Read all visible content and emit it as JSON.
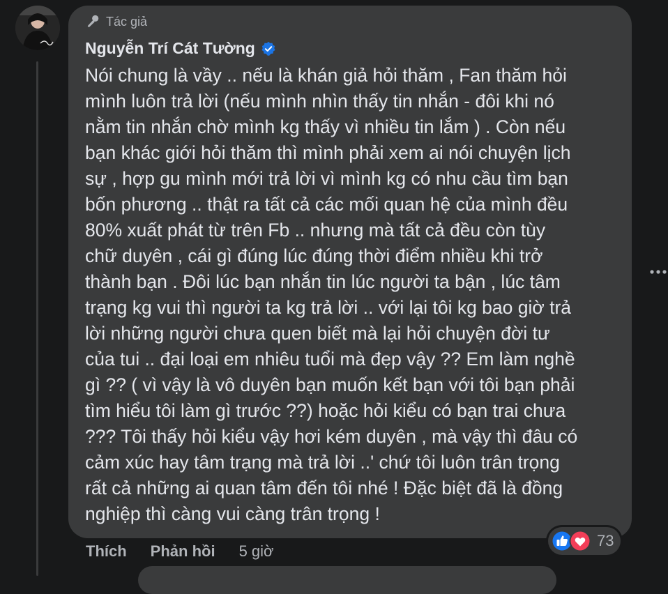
{
  "comment": {
    "badge_label": "Tác giả",
    "author_name": "Nguyễn Trí Cát Tường",
    "text": "Nói chung là vầy .. nếu là khán giả hỏi thăm , Fan thăm hỏi\nmình luôn trả lời (nếu mình nhìn thấy tin nhắn - đôi khi nó\nnằm tin nhắn chờ mình kg thấy vì nhiều tin lắm ) . Còn nếu\nbạn khác giới hỏi thăm thì mình phải xem ai nói chuyện lịch\nsự , hợp gu mình mới trả lời vì mình kg có nhu cầu tìm bạn\nbốn phương .. thật ra tất cả các mối quan hệ của mình đều\n80% xuất phát từ trên Fb .. nhưng mà tất cả đều còn tùy\nchữ duyên , cái gì đúng lúc đúng thời điểm nhiều khi trở\nthành bạn . Đôi lúc bạn nhắn tin lúc người ta bận , lúc tâm\ntrạng kg vui thì người ta kg trả lời .. với lại tôi kg bao giờ trả\nlời những người chưa quen biết mà lại hỏi chuyện đời tư\ncủa tui .. đại loại em nhiêu tuổi mà đẹp vậy ?? Em làm nghề\ngì ?? ( vì vậy là vô duyên bạn muốn kết bạn với tôi bạn phải\ntìm hiểu tôi làm gì trước ??) hoặc hỏi kiểu có bạn trai chưa\n??? Tôi thấy hỏi kiểu vậy hơi kém duyên , mà vậy thì đâu có\ncảm xúc hay tâm trạng mà trả lời ..' chứ tôi luôn trân trọng\nrất cả những ai quan tâm đến tôi nhé ! Đặc biệt đã là đồng\nnghiệp thì càng vui càng trân trọng !"
  },
  "actions": {
    "like_label": "Thích",
    "reply_label": "Phản hồi",
    "time_label": "5 giờ"
  },
  "reactions": {
    "count": "73",
    "types": [
      "like",
      "love"
    ]
  },
  "icons": {
    "badge": "microphone-icon",
    "verified": "verified-badge-icon",
    "more": "more-options-icon"
  },
  "colors": {
    "background": "#18191a",
    "bubble": "#3a3b3c",
    "primary_text": "#e4e6eb",
    "secondary_text": "#b0b3b8",
    "verified_blue": "#1b74e4",
    "like_blue": "#1877f2",
    "love_red": "#f33e58"
  }
}
